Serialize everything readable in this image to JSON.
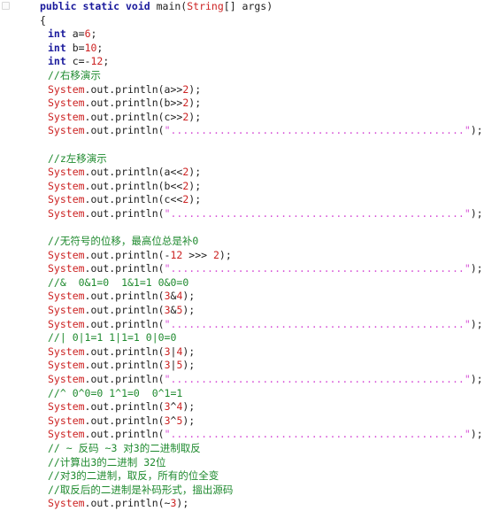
{
  "editor": {
    "language": "java",
    "title": "Java bitwise operators demo",
    "font_size_px": 11.5,
    "background": "#ffffff",
    "colors": {
      "keyword": "#1a1a9c",
      "class_name": "#cc2222",
      "number": "#cc2222",
      "comment": "#1f8a2f",
      "string": "#d64fd6",
      "plain_text": "#202020"
    },
    "separator_string": "................................................",
    "lines": [
      {
        "n": 1,
        "indent": 1,
        "tokens": [
          {
            "t": "public",
            "c": "kw"
          },
          {
            "t": " ",
            "c": "plain"
          },
          {
            "t": "static",
            "c": "kw"
          },
          {
            "t": " ",
            "c": "plain"
          },
          {
            "t": "void",
            "c": "kw"
          },
          {
            "t": " main(",
            "c": "plain"
          },
          {
            "t": "String",
            "c": "cls"
          },
          {
            "t": "[] args)",
            "c": "plain"
          }
        ]
      },
      {
        "n": 2,
        "indent": 1,
        "tokens": [
          {
            "t": "{",
            "c": "plain"
          }
        ]
      },
      {
        "n": 3,
        "indent": 3,
        "tokens": [
          {
            "t": "int",
            "c": "kw"
          },
          {
            "t": " a=",
            "c": "plain"
          },
          {
            "t": "6",
            "c": "num"
          },
          {
            "t": ";",
            "c": "plain"
          }
        ]
      },
      {
        "n": 4,
        "indent": 3,
        "tokens": [
          {
            "t": "int",
            "c": "kw"
          },
          {
            "t": " b=",
            "c": "plain"
          },
          {
            "t": "10",
            "c": "num"
          },
          {
            "t": ";",
            "c": "plain"
          }
        ]
      },
      {
        "n": 5,
        "indent": 3,
        "tokens": [
          {
            "t": "int",
            "c": "kw"
          },
          {
            "t": " c=-",
            "c": "plain"
          },
          {
            "t": "12",
            "c": "num"
          },
          {
            "t": ";",
            "c": "plain"
          }
        ]
      },
      {
        "n": 6,
        "indent": 3,
        "tokens": [
          {
            "t": "//右移演示",
            "c": "cmt"
          }
        ]
      },
      {
        "n": 7,
        "indent": 3,
        "tokens": [
          {
            "t": "System",
            "c": "cls"
          },
          {
            "t": ".out.println(a>>",
            "c": "plain"
          },
          {
            "t": "2",
            "c": "num"
          },
          {
            "t": ");",
            "c": "plain"
          }
        ]
      },
      {
        "n": 8,
        "indent": 3,
        "tokens": [
          {
            "t": "System",
            "c": "cls"
          },
          {
            "t": ".out.println(b>>",
            "c": "plain"
          },
          {
            "t": "2",
            "c": "num"
          },
          {
            "t": ");",
            "c": "plain"
          }
        ]
      },
      {
        "n": 9,
        "indent": 3,
        "tokens": [
          {
            "t": "System",
            "c": "cls"
          },
          {
            "t": ".out.println(c>>",
            "c": "plain"
          },
          {
            "t": "2",
            "c": "num"
          },
          {
            "t": ");",
            "c": "plain"
          }
        ]
      },
      {
        "n": 10,
        "indent": 3,
        "tokens": [
          {
            "t": "System",
            "c": "cls"
          },
          {
            "t": ".out.println(",
            "c": "plain"
          },
          {
            "t": "\"................................................\"",
            "c": "str"
          },
          {
            "t": ");",
            "c": "plain"
          }
        ]
      },
      {
        "n": 11,
        "indent": 3,
        "tokens": []
      },
      {
        "n": 12,
        "indent": 3,
        "tokens": [
          {
            "t": "//z左移演示",
            "c": "cmt"
          }
        ]
      },
      {
        "n": 13,
        "indent": 3,
        "tokens": [
          {
            "t": "System",
            "c": "cls"
          },
          {
            "t": ".out.println(a<<",
            "c": "plain"
          },
          {
            "t": "2",
            "c": "num"
          },
          {
            "t": ");",
            "c": "plain"
          }
        ]
      },
      {
        "n": 14,
        "indent": 3,
        "tokens": [
          {
            "t": "System",
            "c": "cls"
          },
          {
            "t": ".out.println(b<<",
            "c": "plain"
          },
          {
            "t": "2",
            "c": "num"
          },
          {
            "t": ");",
            "c": "plain"
          }
        ]
      },
      {
        "n": 15,
        "indent": 3,
        "tokens": [
          {
            "t": "System",
            "c": "cls"
          },
          {
            "t": ".out.println(c<<",
            "c": "plain"
          },
          {
            "t": "2",
            "c": "num"
          },
          {
            "t": ");",
            "c": "plain"
          }
        ]
      },
      {
        "n": 16,
        "indent": 3,
        "tokens": [
          {
            "t": "System",
            "c": "cls"
          },
          {
            "t": ".out.println(",
            "c": "plain"
          },
          {
            "t": "\"................................................\"",
            "c": "str"
          },
          {
            "t": ");",
            "c": "plain"
          }
        ]
      },
      {
        "n": 17,
        "indent": 3,
        "tokens": []
      },
      {
        "n": 18,
        "indent": 3,
        "tokens": [
          {
            "t": "//无符号的位移，最高位总是补0",
            "c": "cmt"
          }
        ]
      },
      {
        "n": 19,
        "indent": 3,
        "tokens": [
          {
            "t": "System",
            "c": "cls"
          },
          {
            "t": ".out.println(-",
            "c": "plain"
          },
          {
            "t": "12",
            "c": "num"
          },
          {
            "t": " >>> ",
            "c": "plain"
          },
          {
            "t": "2",
            "c": "num"
          },
          {
            "t": ");",
            "c": "plain"
          }
        ]
      },
      {
        "n": 20,
        "indent": 3,
        "tokens": [
          {
            "t": "System",
            "c": "cls"
          },
          {
            "t": ".out.println(",
            "c": "plain"
          },
          {
            "t": "\"................................................\"",
            "c": "str"
          },
          {
            "t": ");",
            "c": "plain"
          }
        ]
      },
      {
        "n": 21,
        "indent": 3,
        "tokens": [
          {
            "t": "//&  0&1=0  1&1=1 0&0=0",
            "c": "cmt"
          }
        ]
      },
      {
        "n": 22,
        "indent": 3,
        "tokens": [
          {
            "t": "System",
            "c": "cls"
          },
          {
            "t": ".out.println(",
            "c": "plain"
          },
          {
            "t": "3",
            "c": "num"
          },
          {
            "t": "&",
            "c": "plain"
          },
          {
            "t": "4",
            "c": "num"
          },
          {
            "t": ");",
            "c": "plain"
          }
        ]
      },
      {
        "n": 23,
        "indent": 3,
        "tokens": [
          {
            "t": "System",
            "c": "cls"
          },
          {
            "t": ".out.println(",
            "c": "plain"
          },
          {
            "t": "3",
            "c": "num"
          },
          {
            "t": "&",
            "c": "plain"
          },
          {
            "t": "5",
            "c": "num"
          },
          {
            "t": ");",
            "c": "plain"
          }
        ]
      },
      {
        "n": 24,
        "indent": 3,
        "tokens": [
          {
            "t": "System",
            "c": "cls"
          },
          {
            "t": ".out.println(",
            "c": "plain"
          },
          {
            "t": "\"................................................\"",
            "c": "str"
          },
          {
            "t": ");",
            "c": "plain"
          }
        ]
      },
      {
        "n": 25,
        "indent": 3,
        "tokens": [
          {
            "t": "//| 0|1=1 1|1=1 0|0=0",
            "c": "cmt"
          }
        ]
      },
      {
        "n": 26,
        "indent": 3,
        "tokens": [
          {
            "t": "System",
            "c": "cls"
          },
          {
            "t": ".out.println(",
            "c": "plain"
          },
          {
            "t": "3",
            "c": "num"
          },
          {
            "t": "|",
            "c": "plain"
          },
          {
            "t": "4",
            "c": "num"
          },
          {
            "t": ");",
            "c": "plain"
          }
        ]
      },
      {
        "n": 27,
        "indent": 3,
        "tokens": [
          {
            "t": "System",
            "c": "cls"
          },
          {
            "t": ".out.println(",
            "c": "plain"
          },
          {
            "t": "3",
            "c": "num"
          },
          {
            "t": "|",
            "c": "plain"
          },
          {
            "t": "5",
            "c": "num"
          },
          {
            "t": ");",
            "c": "plain"
          }
        ]
      },
      {
        "n": 28,
        "indent": 3,
        "tokens": [
          {
            "t": "System",
            "c": "cls"
          },
          {
            "t": ".out.println(",
            "c": "plain"
          },
          {
            "t": "\"................................................\"",
            "c": "str"
          },
          {
            "t": ");",
            "c": "plain"
          }
        ]
      },
      {
        "n": 29,
        "indent": 3,
        "tokens": [
          {
            "t": "//^ 0^0=0 1^1=0  0^1=1",
            "c": "cmt"
          }
        ]
      },
      {
        "n": 30,
        "indent": 3,
        "tokens": [
          {
            "t": "System",
            "c": "cls"
          },
          {
            "t": ".out.println(",
            "c": "plain"
          },
          {
            "t": "3",
            "c": "num"
          },
          {
            "t": "^",
            "c": "plain"
          },
          {
            "t": "4",
            "c": "num"
          },
          {
            "t": ");",
            "c": "plain"
          }
        ]
      },
      {
        "n": 31,
        "indent": 3,
        "tokens": [
          {
            "t": "System",
            "c": "cls"
          },
          {
            "t": ".out.println(",
            "c": "plain"
          },
          {
            "t": "3",
            "c": "num"
          },
          {
            "t": "^",
            "c": "plain"
          },
          {
            "t": "5",
            "c": "num"
          },
          {
            "t": ");",
            "c": "plain"
          }
        ]
      },
      {
        "n": 32,
        "indent": 3,
        "tokens": [
          {
            "t": "System",
            "c": "cls"
          },
          {
            "t": ".out.println(",
            "c": "plain"
          },
          {
            "t": "\"................................................\"",
            "c": "str"
          },
          {
            "t": ");",
            "c": "plain"
          }
        ]
      },
      {
        "n": 33,
        "indent": 3,
        "tokens": [
          {
            "t": "// ~ 反码 ~3 对3的二进制取反",
            "c": "cmt"
          }
        ]
      },
      {
        "n": 34,
        "indent": 3,
        "tokens": [
          {
            "t": "//计算出3的二进制 32位",
            "c": "cmt"
          }
        ]
      },
      {
        "n": 35,
        "indent": 3,
        "tokens": [
          {
            "t": "//对3的二进制，取反，所有的位全变",
            "c": "cmt"
          }
        ]
      },
      {
        "n": 36,
        "indent": 3,
        "tokens": [
          {
            "t": "//取反后的二进制是补码形式，搵出源码",
            "c": "cmt"
          }
        ]
      },
      {
        "n": 37,
        "indent": 3,
        "tokens": [
          {
            "t": "System",
            "c": "cls"
          },
          {
            "t": ".out.println(~",
            "c": "plain"
          },
          {
            "t": "3",
            "c": "num"
          },
          {
            "t": ");",
            "c": "plain"
          }
        ]
      }
    ]
  }
}
